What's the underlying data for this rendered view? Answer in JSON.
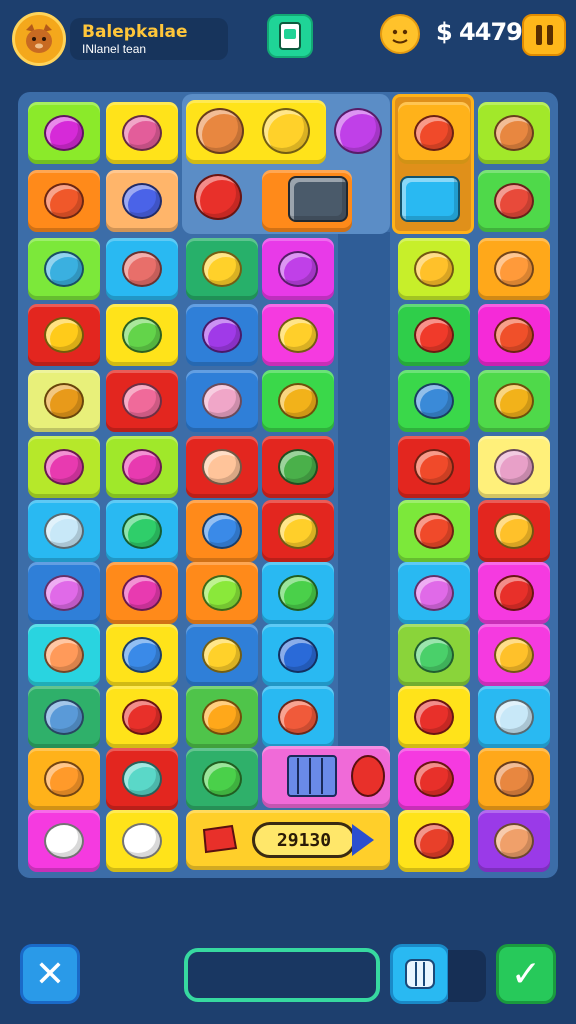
{
  "header": {
    "player_name": "Balepkalae",
    "player_subtitle": "INlanel tean",
    "money": "$ 4479",
    "icons": {
      "avatar": "cat-avatar-icon",
      "card": "card-icon",
      "coin": "coin-icon",
      "pause": "pause-icon"
    }
  },
  "board": {
    "tiles": [
      {
        "row": 0,
        "col": 0,
        "bg": "#8bea2a",
        "fg": "#d62ad8",
        "icon": "heart-icon"
      },
      {
        "row": 0,
        "col": 1,
        "bg": "#ffe31a",
        "fg": "#e35d9a",
        "icon": "marker-icon"
      },
      {
        "row": 0,
        "col": 5,
        "bg": "#ffb21a",
        "fg": "#f04a2a",
        "icon": "face-icon"
      },
      {
        "row": 0,
        "col": 6,
        "bg": "#a2e82a",
        "fg": "#e88740",
        "icon": "bear-icon"
      },
      {
        "row": 1,
        "col": 0,
        "bg": "#ff8a1a",
        "fg": "#f0582a",
        "icon": "balloon-icon"
      },
      {
        "row": 1,
        "col": 1,
        "bg": "#ffb56a",
        "fg": "#4a63e8",
        "icon": "balloon-icon"
      },
      {
        "row": 1,
        "col": 6,
        "bg": "#4fd94a",
        "fg": "#e84a3a",
        "icon": "eraser-icon"
      },
      {
        "row": 2,
        "col": 0,
        "bg": "#7ce83a",
        "fg": "#3ab0e0",
        "icon": "leaf-icon"
      },
      {
        "row": 2,
        "col": 1,
        "bg": "#29b9f2",
        "fg": "#e86f6a",
        "icon": "bowl-icon"
      },
      {
        "row": 2,
        "col": 2,
        "bg": "#27b06a",
        "fg": "#ffd12a",
        "icon": "cat-icon"
      },
      {
        "row": 2,
        "col": 3,
        "bg": "#e83ae8",
        "fg": "#c040e8",
        "icon": "heart-icon"
      },
      {
        "row": 2,
        "col": 5,
        "bg": "#c7ef2a",
        "fg": "#ffc12a",
        "icon": "face-icon"
      },
      {
        "row": 2,
        "col": 6,
        "bg": "#ffa81a",
        "fg": "#ff9a3a",
        "icon": "face-icon"
      },
      {
        "row": 3,
        "col": 0,
        "bg": "#e3261f",
        "fg": "#ffcb1a",
        "icon": "seven-icon"
      },
      {
        "row": 3,
        "col": 1,
        "bg": "#ffe31a",
        "fg": "#63d44a",
        "icon": "frog-icon"
      },
      {
        "row": 3,
        "col": 2,
        "bg": "#2f7fd8",
        "fg": "#a03ae8",
        "icon": "camera-icon"
      },
      {
        "row": 3,
        "col": 3,
        "bg": "#f53ae0",
        "fg": "#ffcf2a",
        "icon": "star-icon"
      },
      {
        "row": 3,
        "col": 5,
        "bg": "#2fce4a",
        "fg": "#f03a2a",
        "icon": "rocket-icon"
      },
      {
        "row": 3,
        "col": 6,
        "bg": "#f52ad8",
        "fg": "#f0502a",
        "icon": "target-icon"
      },
      {
        "row": 4,
        "col": 0,
        "bg": "#e8f07a",
        "fg": "#e89a1a",
        "icon": "toast-icon"
      },
      {
        "row": 4,
        "col": 1,
        "bg": "#e3261f",
        "fg": "#f06a9a",
        "icon": "fish-icon"
      },
      {
        "row": 4,
        "col": 2,
        "bg": "#2f7fd8",
        "fg": "#f0a6c8",
        "icon": "crayon-icon"
      },
      {
        "row": 4,
        "col": 3,
        "bg": "#3ad84a",
        "fg": "#f2b21a",
        "icon": "chat-icon"
      },
      {
        "row": 4,
        "col": 5,
        "bg": "#3ad84a",
        "fg": "#3a8ad8",
        "icon": "blob-icon"
      },
      {
        "row": 4,
        "col": 6,
        "bg": "#4fd94a",
        "fg": "#f2b21a",
        "icon": "chat-icon"
      },
      {
        "row": 5,
        "col": 0,
        "bg": "#b6e82a",
        "fg": "#e83ab0",
        "icon": "crayon-icon"
      },
      {
        "row": 5,
        "col": 1,
        "bg": "#a0e82a",
        "fg": "#e83ab0",
        "icon": "crayon-icon"
      },
      {
        "row": 5,
        "col": 2,
        "bg": "#e3261f",
        "fg": "#ffc49a",
        "icon": "face-icon"
      },
      {
        "row": 5,
        "col": 3,
        "bg": "#e3261f",
        "fg": "#4ab04a",
        "icon": "leaf-icon"
      },
      {
        "row": 5,
        "col": 5,
        "bg": "#e3261f",
        "fg": "#f04a2a",
        "icon": "face-icon"
      },
      {
        "row": 5,
        "col": 6,
        "bg": "#fff07a",
        "fg": "#e8a0c8",
        "icon": "eraser-icon"
      },
      {
        "row": 6,
        "col": 0,
        "bg": "#29b9f2",
        "fg": "#c8e8f8",
        "icon": "bubble-icon"
      },
      {
        "row": 6,
        "col": 1,
        "bg": "#29b9f2",
        "fg": "#2fce6a",
        "icon": "triangle-icon"
      },
      {
        "row": 6,
        "col": 2,
        "bg": "#ff8a1a",
        "fg": "#3a8ae8",
        "icon": "heart-icon"
      },
      {
        "row": 6,
        "col": 3,
        "bg": "#e3261f",
        "fg": "#ffcf2a",
        "icon": "triangle-icon"
      },
      {
        "row": 6,
        "col": 5,
        "bg": "#7ce83a",
        "fg": "#f04a2a",
        "icon": "pin-icon"
      },
      {
        "row": 6,
        "col": 6,
        "bg": "#e3261f",
        "fg": "#ffc12a",
        "icon": "cat-icon"
      },
      {
        "row": 7,
        "col": 0,
        "bg": "#2f7fd8",
        "fg": "#e06ae8",
        "icon": "crayon-icon"
      },
      {
        "row": 7,
        "col": 1,
        "bg": "#ff8a1a",
        "fg": "#e83ab0",
        "icon": "dice-icon"
      },
      {
        "row": 7,
        "col": 2,
        "bg": "#ff8a1a",
        "fg": "#8ae83a",
        "icon": "face-icon"
      },
      {
        "row": 7,
        "col": 3,
        "bg": "#29b9f2",
        "fg": "#4ad04a",
        "icon": "bug-icon"
      },
      {
        "row": 7,
        "col": 5,
        "bg": "#29b9f2",
        "fg": "#e06ae8",
        "icon": "balloon-icon"
      },
      {
        "row": 7,
        "col": 6,
        "bg": "#f53ae0",
        "fg": "#e8302a",
        "icon": "robot-icon"
      },
      {
        "row": 8,
        "col": 0,
        "bg": "#29d4e0",
        "fg": "#ff9a5a",
        "icon": "face-icon"
      },
      {
        "row": 8,
        "col": 1,
        "bg": "#ffe31a",
        "fg": "#3a8ae8",
        "icon": "ball-icon"
      },
      {
        "row": 8,
        "col": 2,
        "bg": "#2f7fd8",
        "fg": "#ffd12a",
        "icon": "lemon-icon"
      },
      {
        "row": 8,
        "col": 3,
        "bg": "#29b9f2",
        "fg": "#2a6ad8",
        "icon": "cone-icon"
      },
      {
        "row": 8,
        "col": 5,
        "bg": "#8ad43a",
        "fg": "#4ad06a",
        "icon": "cat-icon"
      },
      {
        "row": 8,
        "col": 6,
        "bg": "#f53ae0",
        "fg": "#ffc12a",
        "icon": "cat-icon"
      },
      {
        "row": 9,
        "col": 0,
        "bg": "#2fb06a",
        "fg": "#5a9ad8",
        "icon": "face-icon"
      },
      {
        "row": 9,
        "col": 1,
        "bg": "#ffe31a",
        "fg": "#e8302a",
        "icon": "heart-icon"
      },
      {
        "row": 9,
        "col": 2,
        "bg": "#4fc44a",
        "fg": "#ffa81a",
        "icon": "leaf-icon"
      },
      {
        "row": 9,
        "col": 3,
        "bg": "#29b9f2",
        "fg": "#f05a3a",
        "icon": "bandage-icon"
      },
      {
        "row": 9,
        "col": 5,
        "bg": "#ffe31a",
        "fg": "#e8302a",
        "icon": "face-icon"
      },
      {
        "row": 9,
        "col": 6,
        "bg": "#29b9f2",
        "fg": "#c8e8f8",
        "icon": "bubble-icon"
      },
      {
        "row": 10,
        "col": 0,
        "bg": "#ffb21a",
        "fg": "#ff9a2a",
        "icon": "face-icon"
      },
      {
        "row": 10,
        "col": 1,
        "bg": "#e3261f",
        "fg": "#5ad8c8",
        "icon": "ball-icon"
      },
      {
        "row": 10,
        "col": 2,
        "bg": "#2fb06a",
        "fg": "#4ad04a",
        "icon": "turtle-icon"
      },
      {
        "row": 10,
        "col": 5,
        "bg": "#f53ae0",
        "fg": "#e8302a",
        "icon": "bird-icon"
      },
      {
        "row": 10,
        "col": 6,
        "bg": "#ffa81a",
        "fg": "#e88740",
        "icon": "bear-icon"
      },
      {
        "row": 11,
        "col": 0,
        "bg": "#f53ae0",
        "fg": "#ffffff",
        "icon": "pin-icon"
      },
      {
        "row": 11,
        "col": 1,
        "bg": "#ffe31a",
        "fg": "#ffffff",
        "icon": "bubble-icon"
      },
      {
        "row": 11,
        "col": 5,
        "bg": "#ffe31a",
        "fg": "#e8402a",
        "icon": "cone-icon"
      },
      {
        "row": 11,
        "col": 6,
        "bg": "#9a3ae8",
        "fg": "#f0a06a",
        "icon": "eraser-icon"
      }
    ],
    "upper_panel_items": [
      {
        "icon": "bear-icon",
        "fg": "#e88740"
      },
      {
        "icon": "cat-icon",
        "fg": "#ffd12a"
      },
      {
        "icon": "balloon-icon",
        "fg": "#c040e8"
      },
      {
        "icon": "sun-icon",
        "fg": "#e8302a"
      },
      {
        "icon": "radio-icon",
        "fg": "#4a5a6a"
      },
      {
        "icon": "tablet-icon",
        "fg": "#29b9f2"
      }
    ],
    "score": "29130",
    "bottom_strip_icons": [
      "ticket-icon",
      "scanner-icon",
      "pepper-icon"
    ]
  },
  "bottom_bar": {
    "close_glyph": "✕",
    "confirm_glyph": "✓",
    "progress": 0,
    "icons": {
      "close": "close-icon",
      "booster": "ice-cube-icon",
      "confirm": "checkmark-icon"
    },
    "colors": {
      "close": "#2a9ae8",
      "confirm": "#27c95a",
      "booster": "#29b9f2"
    }
  }
}
